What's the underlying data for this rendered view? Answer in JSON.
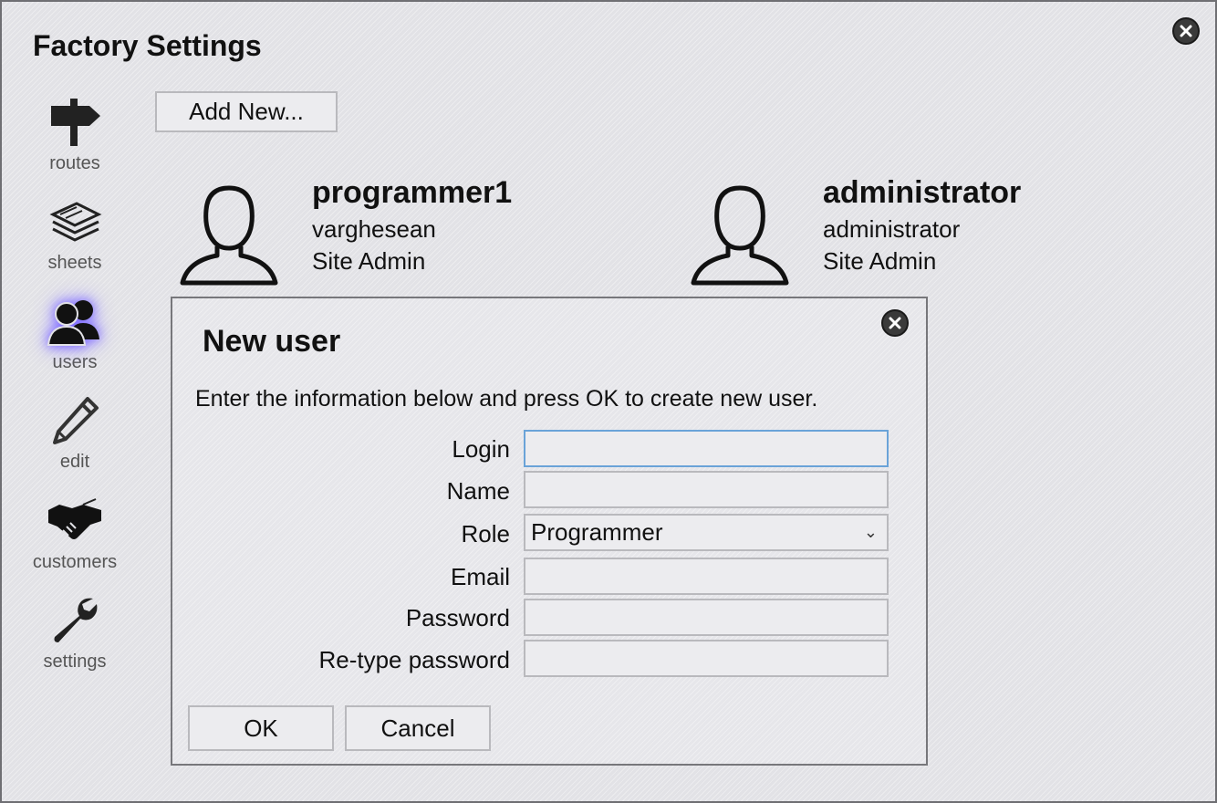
{
  "window": {
    "title": "Factory Settings"
  },
  "sidebar": {
    "items": [
      {
        "label": "routes",
        "icon": "signpost-icon"
      },
      {
        "label": "sheets",
        "icon": "sheets-stack-icon"
      },
      {
        "label": "users",
        "icon": "users-icon",
        "active": true
      },
      {
        "label": "edit",
        "icon": "pencil-icon"
      },
      {
        "label": "customers",
        "icon": "handshake-icon"
      },
      {
        "label": "settings",
        "icon": "wrench-icon"
      }
    ],
    "active_glow_color": "#7e6cff"
  },
  "toolbar": {
    "add_new_label": "Add New..."
  },
  "users": [
    {
      "login": "programmer1",
      "name": "varghesean",
      "role": "Site Admin"
    },
    {
      "login": "administrator",
      "name": "administrator",
      "role": "Site Admin"
    }
  ],
  "dialog": {
    "title": "New user",
    "instructions": "Enter the information below and press OK to create new user.",
    "fields": {
      "login": {
        "label": "Login",
        "value": ""
      },
      "name": {
        "label": "Name",
        "value": ""
      },
      "role": {
        "label": "Role",
        "value": "Programmer"
      },
      "email": {
        "label": "Email",
        "value": ""
      },
      "password": {
        "label": "Password",
        "value": ""
      },
      "retype_password": {
        "label": "Re-type password",
        "value": ""
      }
    },
    "ok_label": "OK",
    "cancel_label": "Cancel"
  },
  "colors": {
    "focus_border": "#6aa3d8",
    "close_button": "#3a3a3a"
  }
}
